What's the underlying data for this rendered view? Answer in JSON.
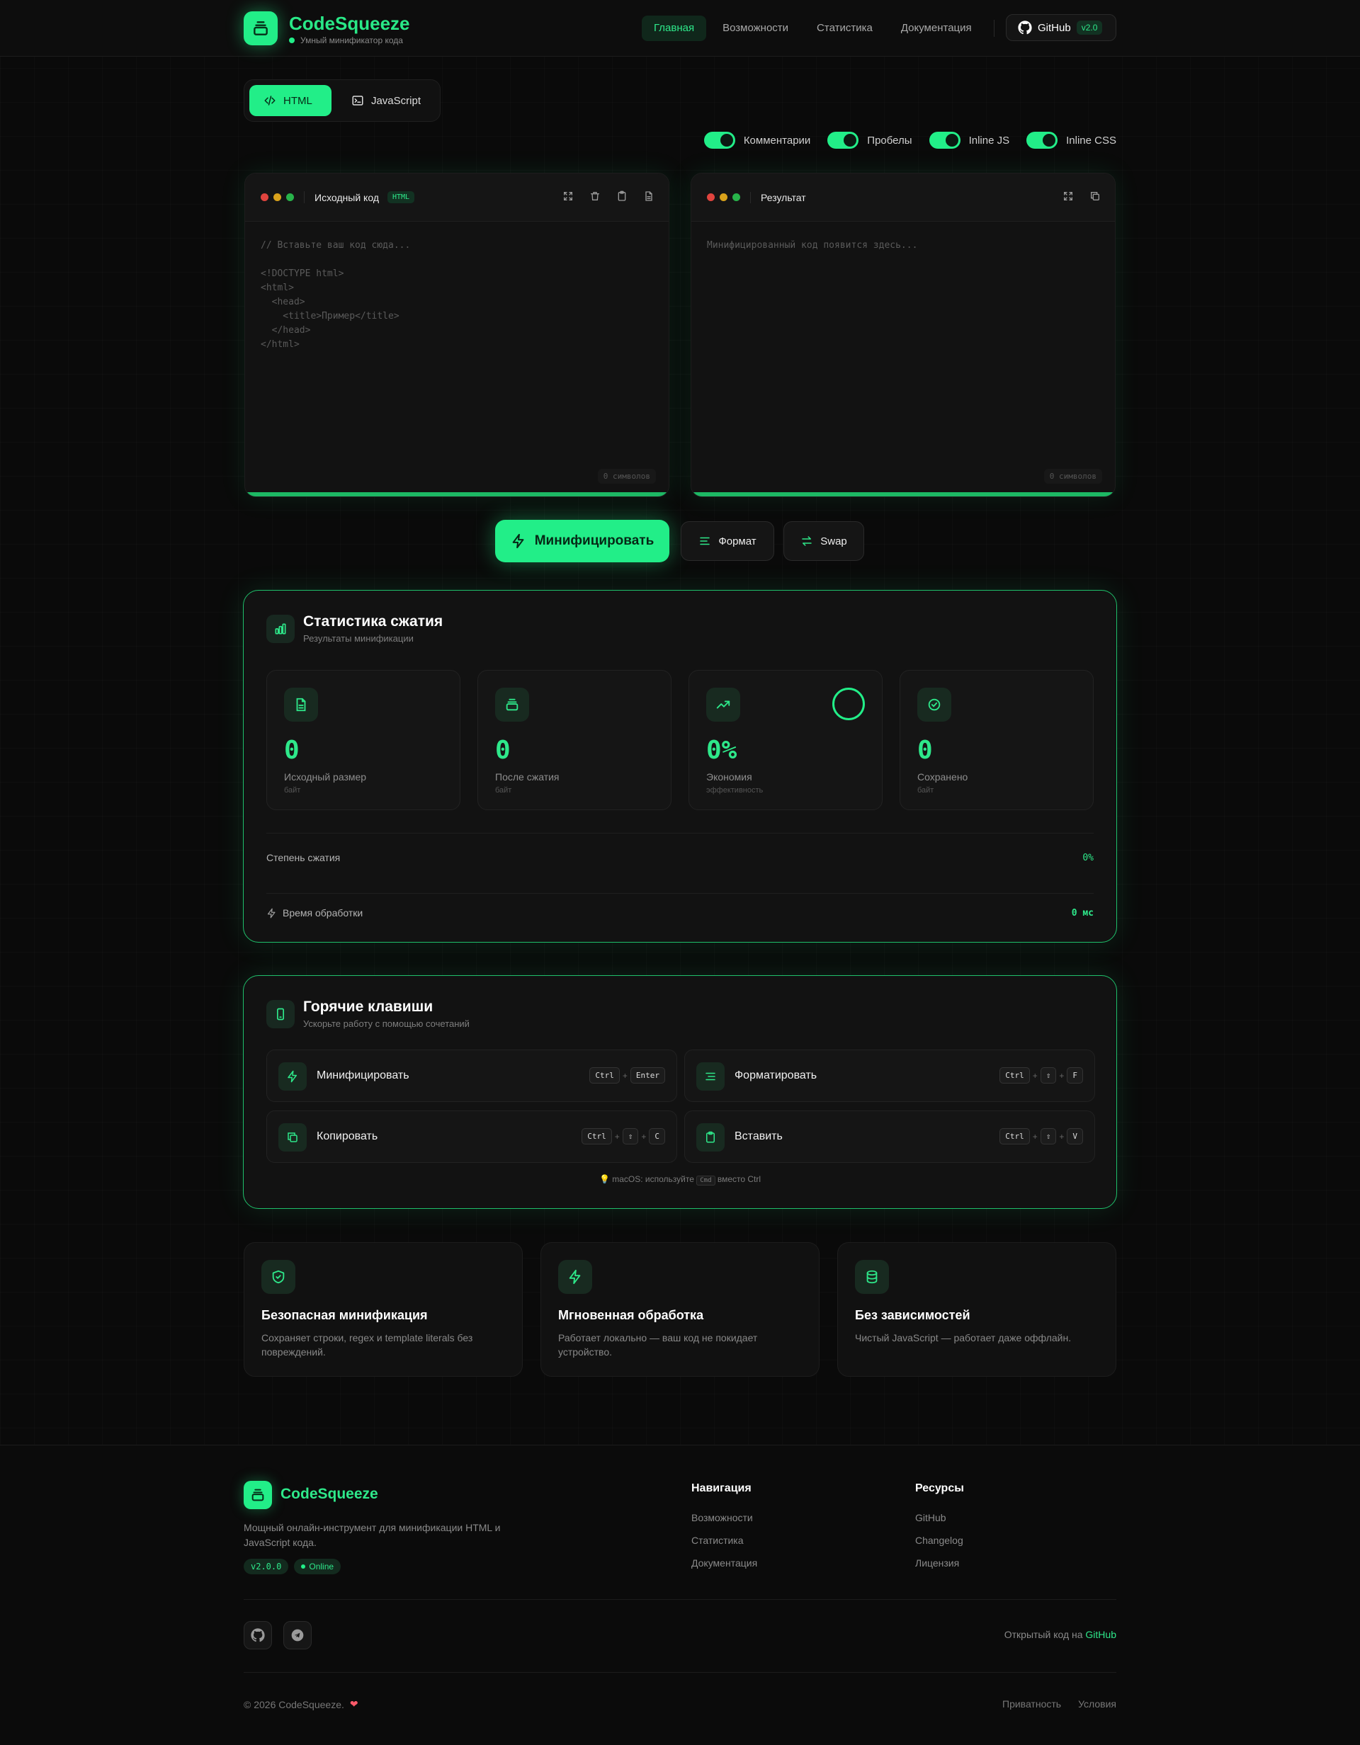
{
  "header": {
    "brand": "CodeSqueeze",
    "tagline": "Умный минификатор кода",
    "nav": [
      "Главная",
      "Возможности",
      "Статистика",
      "Документация"
    ],
    "github_label": "GitHub",
    "version": "v2.0"
  },
  "lang_tabs": [
    "HTML",
    "JavaScript"
  ],
  "toggles": [
    "Комментарии",
    "Пробелы",
    "Inline JS",
    "Inline CSS"
  ],
  "editor_input": {
    "title": "Исходный код",
    "badge": "HTML",
    "placeholder": "// Вставьте ваш код сюда...\n\n<!DOCTYPE html>\n<html>\n  <head>\n    <title>Пример</title>\n  </head>\n</html>",
    "count": "0 символов"
  },
  "editor_output": {
    "title": "Результат",
    "placeholder": "Минифицированный код появится здесь...",
    "count": "0 символов"
  },
  "actions": {
    "minify": "Минифицировать",
    "format": "Формат",
    "swap": "Swap"
  },
  "stats": {
    "title": "Статистика сжатия",
    "subtitle": "Результаты минификации",
    "cards": [
      {
        "value": "0",
        "label": "Исходный размер",
        "unit": "байт"
      },
      {
        "value": "0",
        "label": "После сжатия",
        "unit": "байт"
      },
      {
        "value": "0%",
        "label": "Экономия",
        "unit": "эффективность"
      },
      {
        "value": "0",
        "label": "Сохранено",
        "unit": "байт"
      }
    ],
    "ratio_label": "Степень сжатия",
    "ratio_value": "0%",
    "time_label": "Время обработки",
    "time_value": "0 мс"
  },
  "hotkeys": {
    "title": "Горячие клавиши",
    "subtitle": "Ускорьте работу с помощью сочетаний",
    "items": [
      {
        "label": "Минифицировать",
        "keys": [
          "Ctrl",
          "Enter"
        ]
      },
      {
        "label": "Форматировать",
        "keys": [
          "Ctrl",
          "⇧",
          "F"
        ]
      },
      {
        "label": "Копировать",
        "keys": [
          "Ctrl",
          "⇧",
          "C"
        ]
      },
      {
        "label": "Вставить",
        "keys": [
          "Ctrl",
          "⇧",
          "V"
        ]
      }
    ],
    "mac_prefix": "macOS: используйте",
    "mac_key": "Cmd",
    "mac_suffix": "вместо Ctrl"
  },
  "features": [
    {
      "title": "Безопасная минификация",
      "desc": "Сохраняет строки, regex и template literals без повреждений."
    },
    {
      "title": "Мгновенная обработка",
      "desc": "Работает локально — ваш код не покидает устройство."
    },
    {
      "title": "Без зависимостей",
      "desc": "Чистый JavaScript — работает даже оффлайн."
    }
  ],
  "footer": {
    "brand": "CodeSqueeze",
    "desc": "Мощный онлайн-инструмент для минификации HTML и JavaScript кода.",
    "version": "v2.0.0",
    "status": "Online",
    "nav_title": "Навигация",
    "nav_links": [
      "Возможности",
      "Статистика",
      "Документация"
    ],
    "res_title": "Ресурсы",
    "res_links": [
      "GitHub",
      "Changelog",
      "Лицензия"
    ],
    "open_prefix": "Открытый код на",
    "open_link": "GitHub",
    "copyright": "© 2026 CodeSqueeze.",
    "legal": [
      "Приватность",
      "Условия"
    ]
  },
  "colors": {
    "accent": "#22ee88",
    "background": "#0a0a0a",
    "panel_border": "#1fbf6a"
  }
}
